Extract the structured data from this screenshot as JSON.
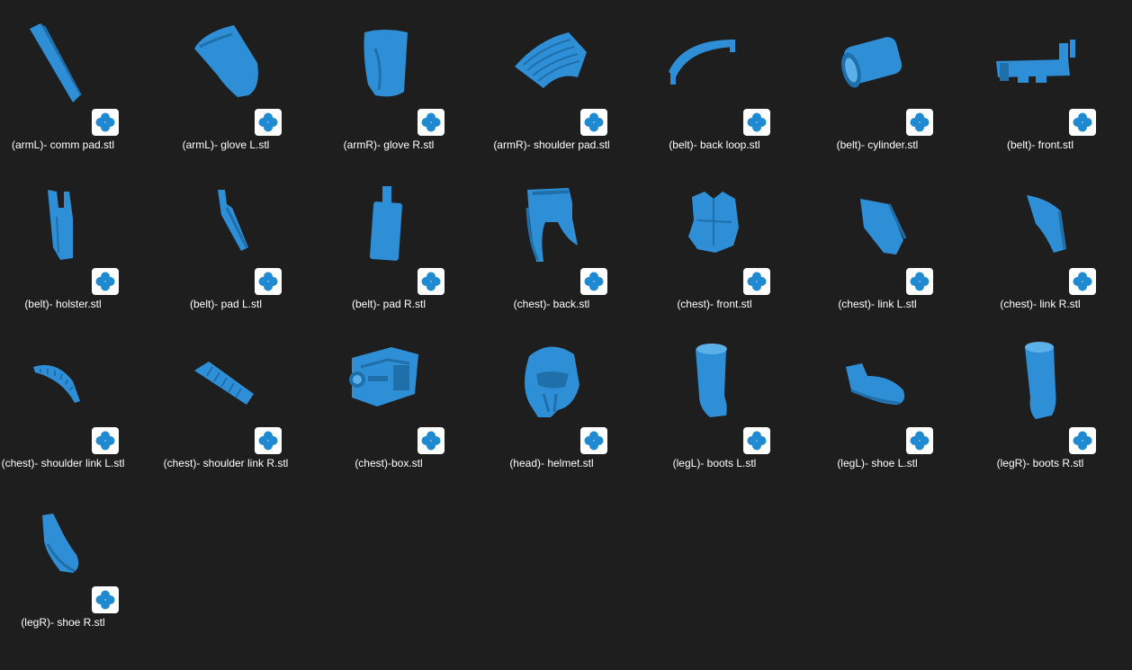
{
  "window": {
    "background_color": "#1e1e1e",
    "model_color": "#2e8fd6",
    "badge_icon": "3d-viewer-app-icon"
  },
  "files": [
    {
      "name": "(armL)- comm pad.stl",
      "thumb": "comm-pad"
    },
    {
      "name": "(armL)- glove L.stl",
      "thumb": "glove-l"
    },
    {
      "name": "(armR)- glove R.stl",
      "thumb": "glove-r"
    },
    {
      "name": "(armR)- shoulder pad.stl",
      "thumb": "shoulder-pad"
    },
    {
      "name": "(belt)- back loop.stl",
      "thumb": "back-loop"
    },
    {
      "name": "(belt)- cylinder.stl",
      "thumb": "cylinder"
    },
    {
      "name": "(belt)- front.stl",
      "thumb": "belt-front"
    },
    {
      "name": "(belt)- holster.stl",
      "thumb": "holster"
    },
    {
      "name": "(belt)- pad L.stl",
      "thumb": "pad-l"
    },
    {
      "name": "(belt)- pad R.stl",
      "thumb": "pad-r"
    },
    {
      "name": "(chest)- back.stl",
      "thumb": "chest-back"
    },
    {
      "name": "(chest)- front.stl",
      "thumb": "chest-front"
    },
    {
      "name": "(chest)- link L.stl",
      "thumb": "link-l"
    },
    {
      "name": "(chest)- link R.stl",
      "thumb": "link-r"
    },
    {
      "name": "(chest)- shoulder link L.stl",
      "thumb": "shoulder-link-l"
    },
    {
      "name": "(chest)- shoulder link R.stl",
      "thumb": "shoulder-link-r"
    },
    {
      "name": "(chest)-box.stl",
      "thumb": "chest-box"
    },
    {
      "name": "(head)- helmet.stl",
      "thumb": "helmet"
    },
    {
      "name": "(legL)- boots L.stl",
      "thumb": "boots-l"
    },
    {
      "name": "(legL)- shoe L.stl",
      "thumb": "shoe-l"
    },
    {
      "name": "(legR)- boots R.stl",
      "thumb": "boots-r"
    },
    {
      "name": "(legR)- shoe R.stl",
      "thumb": "shoe-r"
    }
  ]
}
